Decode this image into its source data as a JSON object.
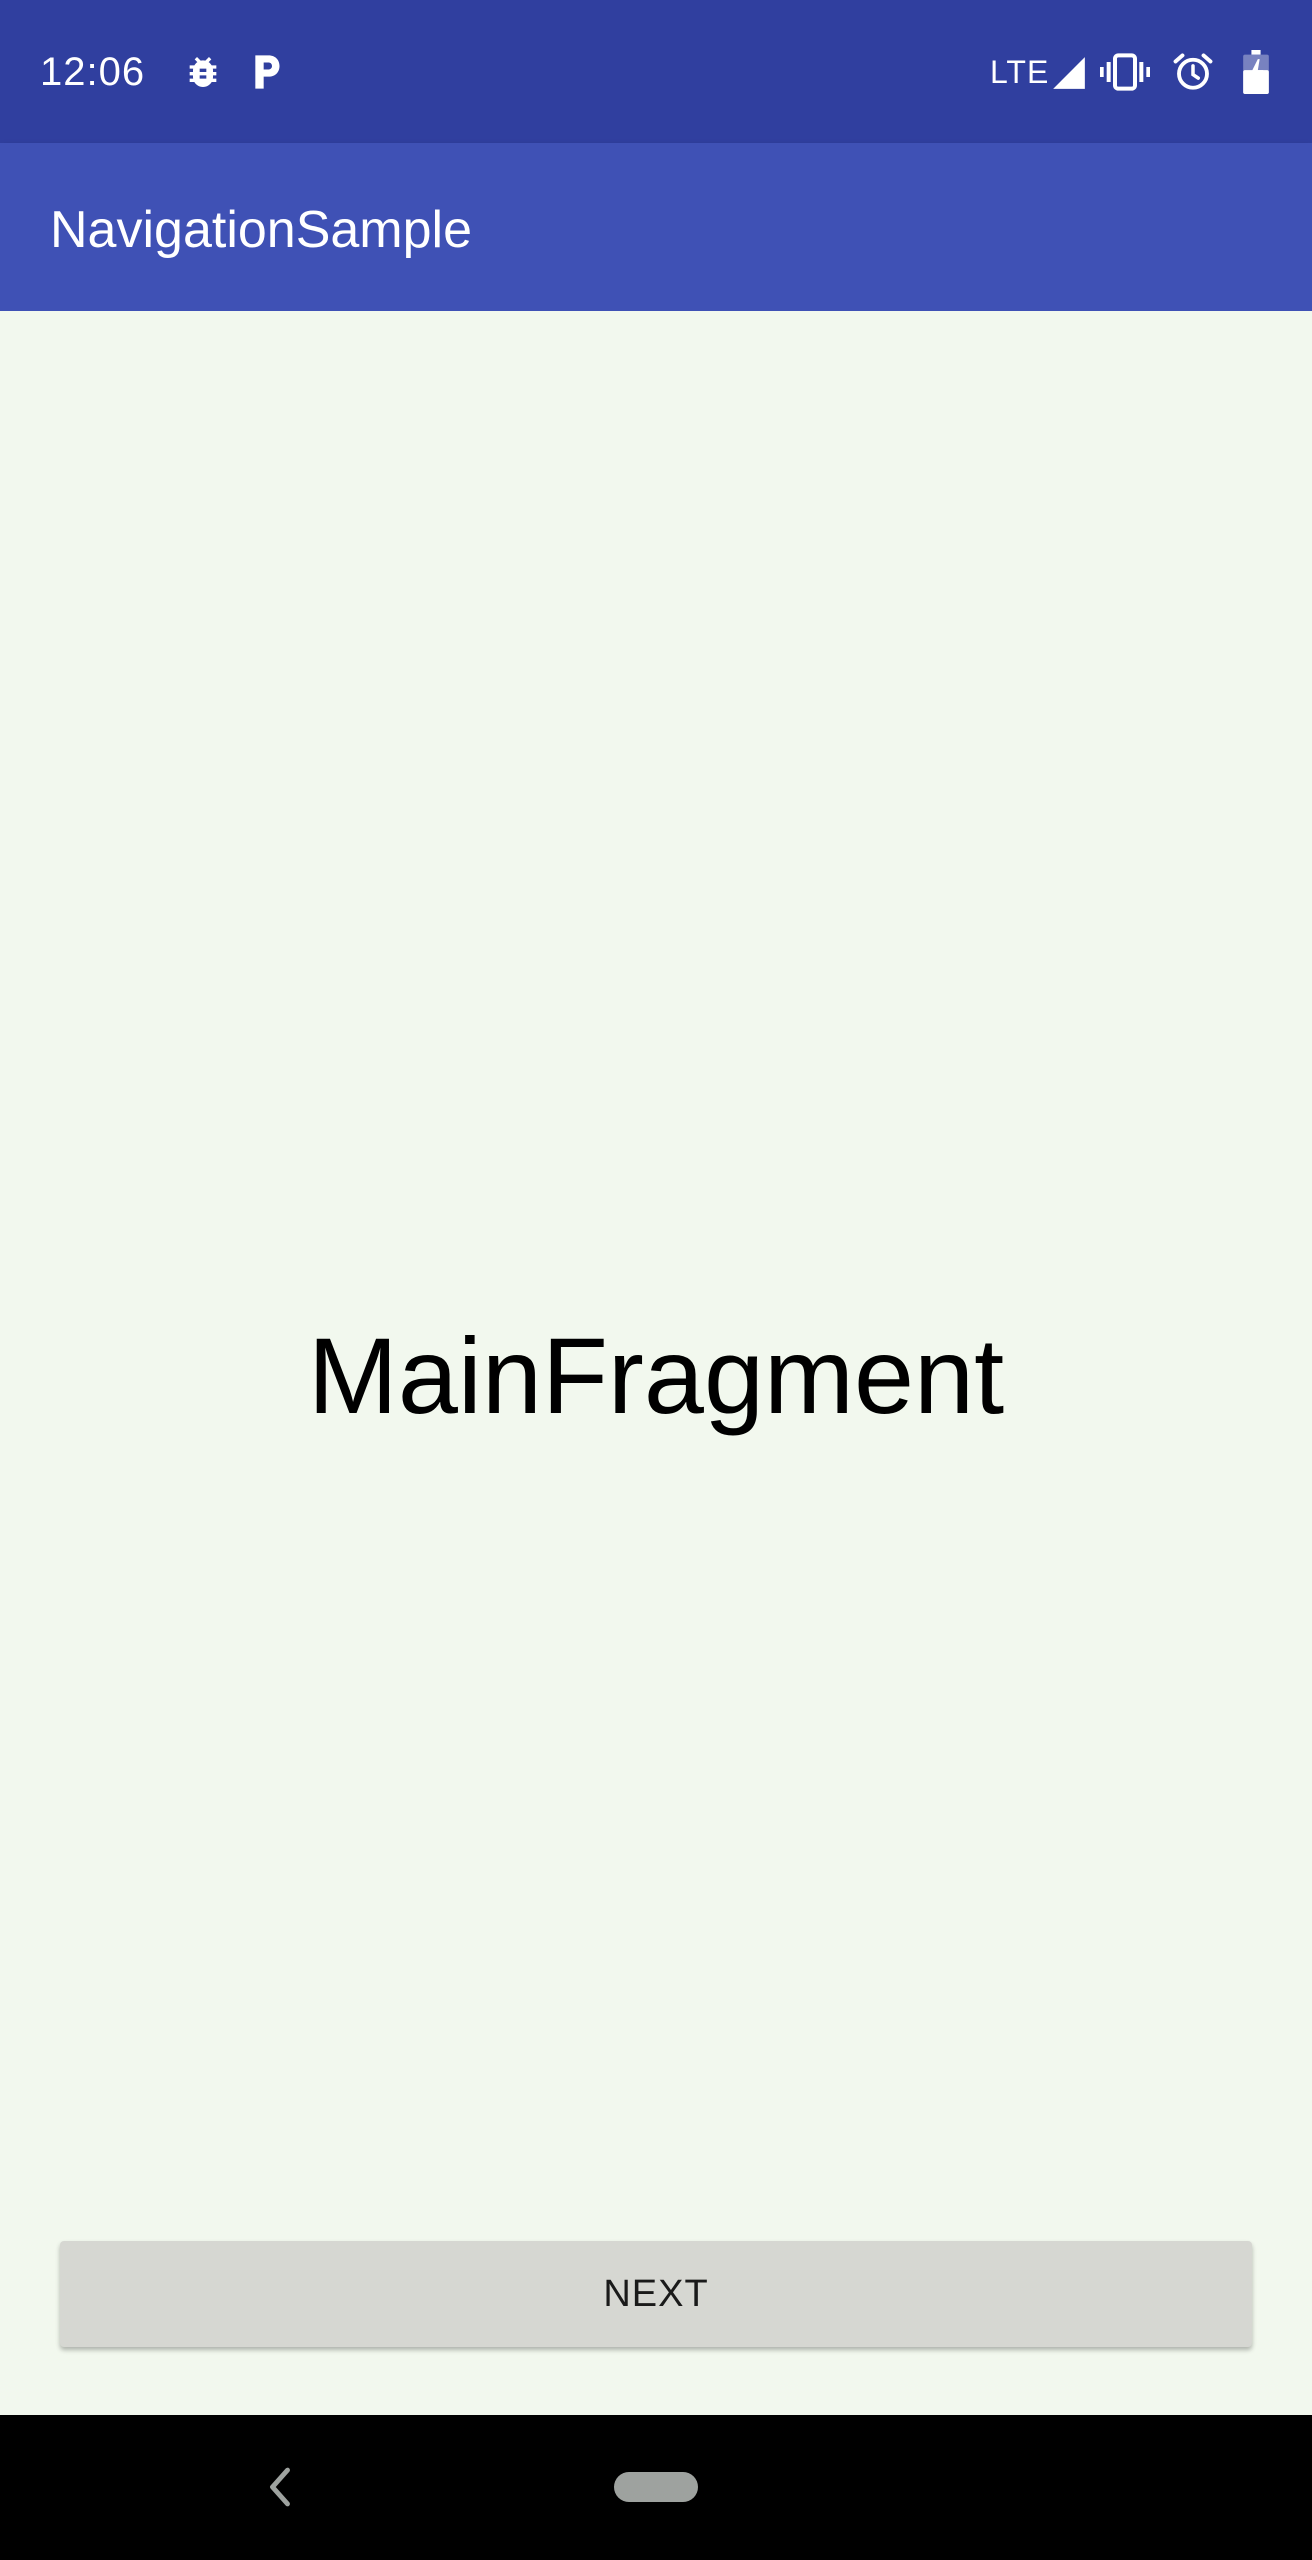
{
  "status_bar": {
    "time": "12:06",
    "network": "LTE",
    "icons": [
      "bug-icon",
      "p-icon",
      "signal-icon",
      "vibrate-icon",
      "alarm-icon",
      "battery-icon"
    ]
  },
  "app_bar": {
    "title": "NavigationSample"
  },
  "content": {
    "fragment_label": "MainFragment",
    "next_button_label": "NEXT"
  },
  "nav_bar": {
    "icons": [
      "back-icon",
      "home-pill"
    ]
  },
  "colors": {
    "status_bar": "#303f9f",
    "app_bar": "#3f51b5",
    "background": "#f2f8ee",
    "button": "#d6d7d2",
    "nav_bar": "#000000"
  }
}
